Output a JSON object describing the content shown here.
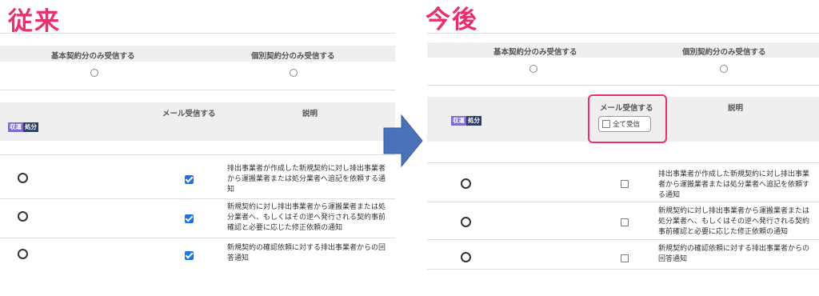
{
  "left": {
    "heading": "従来",
    "top_headers": [
      "基本契約分のみ受信する",
      "個別契約分のみ受信する"
    ],
    "col_mail": "メール受信する",
    "col_desc": "説明",
    "badges": [
      "収運",
      "処分"
    ],
    "rows": [
      {
        "desc": "排出事業者が作成した新規契約に対し排出事業者から運搬業者または処分業者へ追記を依頼する通知",
        "mail": true
      },
      {
        "desc": "新規契約に対し排出事業者から運搬業者または処分業者へ、もしくはその逆へ発行される契約事前確認と必要に応じた修正依頼の通知",
        "mail": true
      },
      {
        "desc": "新規契約の確認依頼に対する排出事業者からの回答通知",
        "mail": true
      }
    ]
  },
  "right": {
    "heading": "今後",
    "top_headers": [
      "基本契約分のみ受信する",
      "個別契約分のみ受信する"
    ],
    "col_mail": "メール受信する",
    "col_desc": "説明",
    "all_receive_label": "全て受信",
    "badges": [
      "収運",
      "処分"
    ],
    "rows": [
      {
        "desc": "排出事業者が作成した新規契約に対し排出事業者から運搬業者または処分業者へ追記を依頼する通知",
        "mail": false
      },
      {
        "desc": "新規契約に対し排出事業者から運搬業者または処分業者へ、もしくはその逆へ発行される契約事前確認と必要に応じた修正依頼の通知",
        "mail": false
      },
      {
        "desc": "新規契約の確認依頼に対する排出事業者からの回答通知",
        "mail": false
      }
    ]
  },
  "colors": {
    "heading": "#e8306f",
    "arrow": "#4a72b8",
    "checkbox": "#1a73e8",
    "badge_a": "#7b6bd6",
    "badge_b": "#2c3e63"
  },
  "icons": {
    "arrow": "right-arrow-icon"
  }
}
